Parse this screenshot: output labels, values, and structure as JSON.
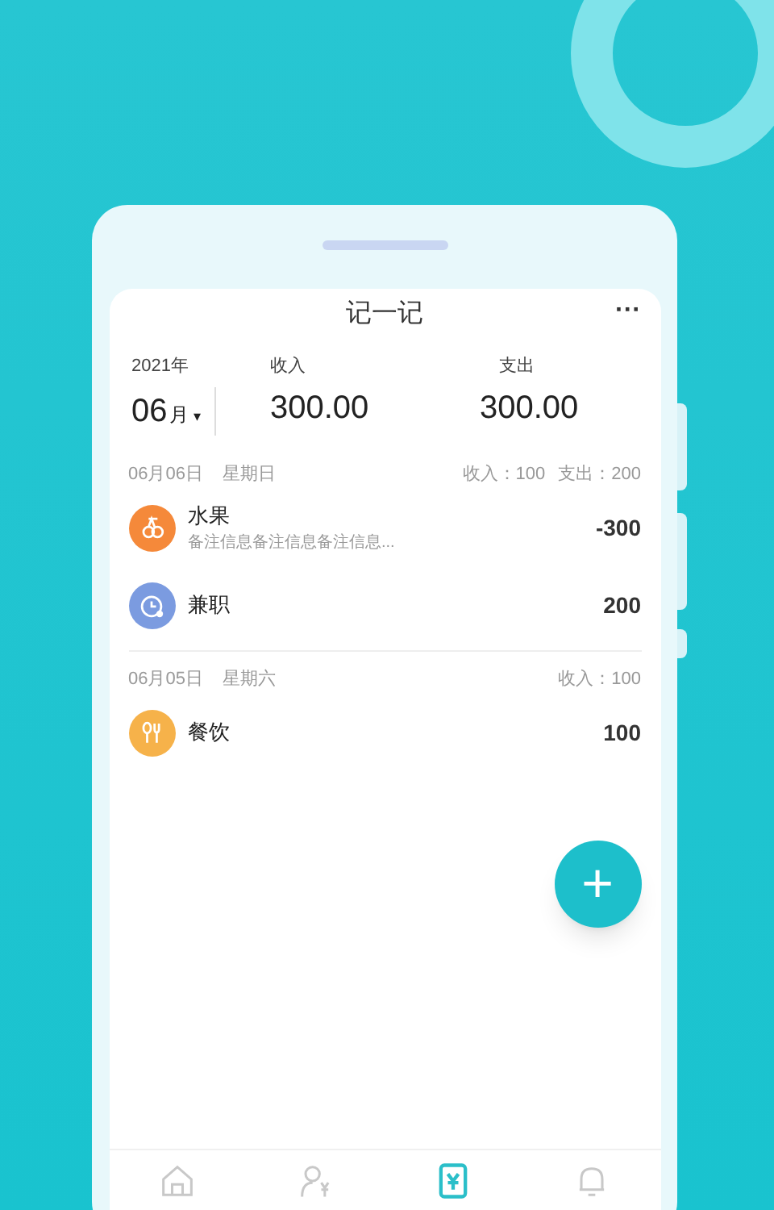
{
  "header": {
    "title": "记一记",
    "more": "···"
  },
  "summary": {
    "year": "2021年",
    "month": "06",
    "month_unit": "月",
    "caret": "▾",
    "income_label": "收入",
    "income": "300.00",
    "expense_label": "支出",
    "expense": "300.00"
  },
  "days": [
    {
      "date": "06月06日",
      "weekday": "星期日",
      "totals": [
        "收入：100",
        "支出：200"
      ],
      "entries": [
        {
          "kind": "fruit",
          "color": "#f5893a",
          "name": "水果",
          "note": "备注信息备注信息备注信息...",
          "amount": "-300"
        },
        {
          "kind": "clock",
          "color": "#7b9be0",
          "name": "兼职",
          "amount": "200"
        }
      ]
    },
    {
      "date": "06月05日",
      "weekday": "星期六",
      "totals": [
        "收入：100"
      ],
      "entries": [
        {
          "kind": "food",
          "color": "#f6b24a",
          "name": "餐饮",
          "amount": "100"
        }
      ]
    }
  ],
  "add_button": "+",
  "tabs": [
    {
      "kind": "home",
      "selected": false
    },
    {
      "kind": "member",
      "selected": false
    },
    {
      "kind": "ledger",
      "selected": true
    },
    {
      "kind": "bell",
      "selected": false
    }
  ]
}
